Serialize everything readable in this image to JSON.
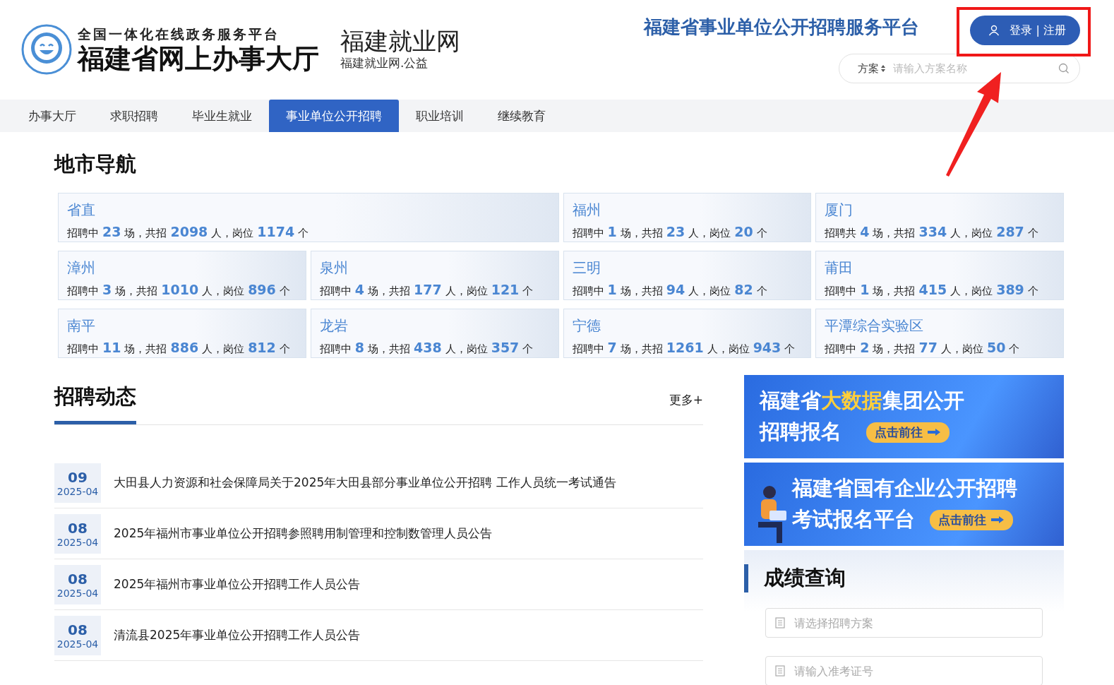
{
  "header": {
    "logo_top": "全国一体化在线政务服务平台",
    "logo_main": "福建省网上办事大厅",
    "site_name": "福建就业网",
    "site_sub": "福建就业网.公益",
    "platform_title": "福建省事业单位公开招聘服务平台",
    "login_button": "登录 | 注册",
    "search": {
      "scope": "方案",
      "placeholder": "请输入方案名称"
    }
  },
  "nav": [
    {
      "label": "办事大厅",
      "selected": false
    },
    {
      "label": "求职招聘",
      "selected": false
    },
    {
      "label": "毕业生就业",
      "selected": false
    },
    {
      "label": "事业单位公开招聘",
      "selected": true
    },
    {
      "label": "职业培训",
      "selected": false
    },
    {
      "label": "继续教育",
      "selected": false
    }
  ],
  "city_nav": {
    "title": "地市导航",
    "cities": [
      {
        "name": "省直",
        "wide": true,
        "parts": [
          "招聘中",
          "23",
          "场，共招",
          "2098",
          "人，岗位",
          "1174",
          "个"
        ]
      },
      {
        "name": "福州",
        "wide": false,
        "parts": [
          "招聘中",
          "1",
          "场，共招",
          "23",
          "人，岗位",
          "20",
          "个"
        ]
      },
      {
        "name": "厦门",
        "wide": false,
        "parts": [
          "招聘共",
          "4",
          "场，共招",
          "334",
          "人，岗位",
          "287",
          "个"
        ]
      },
      {
        "name": "漳州",
        "wide": false,
        "parts": [
          "招聘中",
          "3",
          "场，共招",
          "1010",
          "人，岗位",
          "896",
          "个"
        ]
      },
      {
        "name": "泉州",
        "wide": false,
        "parts": [
          "招聘中",
          "4",
          "场，共招",
          "177",
          "人，岗位",
          "121",
          "个"
        ]
      },
      {
        "name": "三明",
        "wide": false,
        "parts": [
          "招聘中",
          "1",
          "场，共招",
          "94",
          "人，岗位",
          "82",
          "个"
        ]
      },
      {
        "name": "莆田",
        "wide": false,
        "parts": [
          "招聘中",
          "1",
          "场，共招",
          "415",
          "人，岗位",
          "389",
          "个"
        ]
      },
      {
        "name": "南平",
        "wide": false,
        "parts": [
          "招聘中",
          "11",
          "场，共招",
          "886",
          "人，岗位",
          "812",
          "个"
        ]
      },
      {
        "name": "龙岩",
        "wide": false,
        "parts": [
          "招聘中",
          "8",
          "场，共招",
          "438",
          "人，岗位",
          "357",
          "个"
        ]
      },
      {
        "name": "宁德",
        "wide": false,
        "parts": [
          "招聘中",
          "7",
          "场，共招",
          "1261",
          "人，岗位",
          "943",
          "个"
        ]
      },
      {
        "name": "平潭综合实验区",
        "wide": false,
        "parts": [
          "招聘中",
          "2",
          "场，共招",
          "77",
          "人，岗位",
          "50",
          "个"
        ]
      }
    ]
  },
  "news": {
    "title": "招聘动态",
    "more": "更多+",
    "items": [
      {
        "day": "09",
        "month": "2025-04",
        "title": "大田县人力资源和社会保障局关于2025年大田县部分事业单位公开招聘 工作人员统一考试通告"
      },
      {
        "day": "08",
        "month": "2025-04",
        "title": "2025年福州市事业单位公开招聘参照聘用制管理和控制数管理人员公告"
      },
      {
        "day": "08",
        "month": "2025-04",
        "title": "2025年福州市事业单位公开招聘工作人员公告"
      },
      {
        "day": "08",
        "month": "2025-04",
        "title": "清流县2025年事业单位公开招聘工作人员公告"
      }
    ]
  },
  "banners": [
    {
      "lines": [
        [
          {
            "text": "福建省",
            "highlight": false
          },
          {
            "text": "大数据",
            "highlight": true
          },
          {
            "text": "集团公开",
            "highlight": false
          }
        ],
        [
          {
            "text": "招聘报名",
            "highlight": false
          }
        ]
      ],
      "cta": "点击前往"
    },
    {
      "lines": [
        [
          {
            "text": "福建省国有企业公开招聘",
            "highlight": false
          }
        ],
        [
          {
            "text": "考试报名平台",
            "highlight": false
          }
        ]
      ],
      "cta": "点击前往"
    }
  ],
  "score_query": {
    "title": "成绩查询",
    "fields": [
      {
        "placeholder": "请选择招聘方案"
      },
      {
        "placeholder": "请输入准考证号"
      }
    ]
  }
}
